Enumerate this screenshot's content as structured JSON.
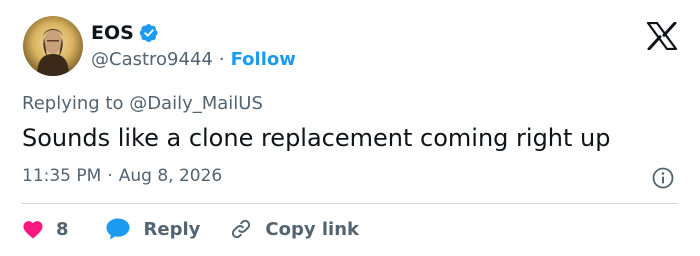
{
  "tweet": {
    "author": {
      "display_name": "EOS",
      "handle": "@Castro9444",
      "separator": "·",
      "follow_label": "Follow",
      "verified": true
    },
    "reply_context": "Replying to @Daily_MailUS",
    "text": "Sounds like a clone replacement coming right up",
    "time": "11:35 PM",
    "date_separator": "·",
    "date": "Aug 8, 2026",
    "likes": "8",
    "reply_label": "Reply",
    "copy_link_label": "Copy link"
  },
  "icons": {
    "logo": "x-logo-icon",
    "verified": "verified-badge-icon",
    "info": "info-icon",
    "like": "heart-icon",
    "reply": "speech-bubble-icon",
    "copy": "link-icon"
  },
  "colors": {
    "accent": "#1d9bf0",
    "like": "#f91880",
    "text_primary": "#0f1419",
    "text_secondary": "#536471",
    "divider": "#cfd9de"
  }
}
